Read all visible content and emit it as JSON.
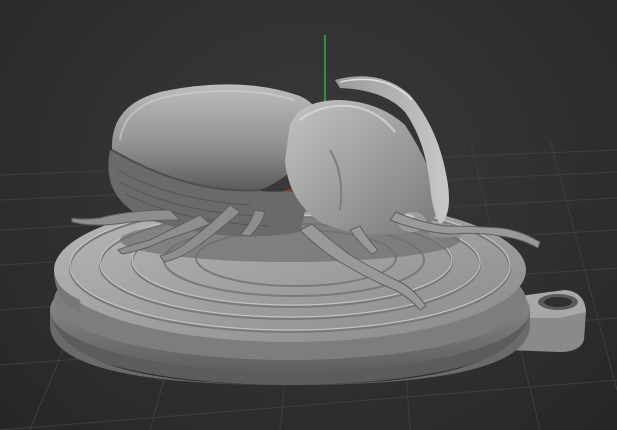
{
  "viewport": {
    "background": "#303030",
    "grid_color": "#3d3d3d",
    "axis_y_color": "#2ecc40",
    "axis_x_color": "#c0392b",
    "model_color": "#8c8c8c"
  },
  "scene": {
    "object": "rhinoceros-beetle-on-round-pendant",
    "icons": [
      "beetle-model",
      "pendant-base",
      "bail-loop"
    ]
  }
}
